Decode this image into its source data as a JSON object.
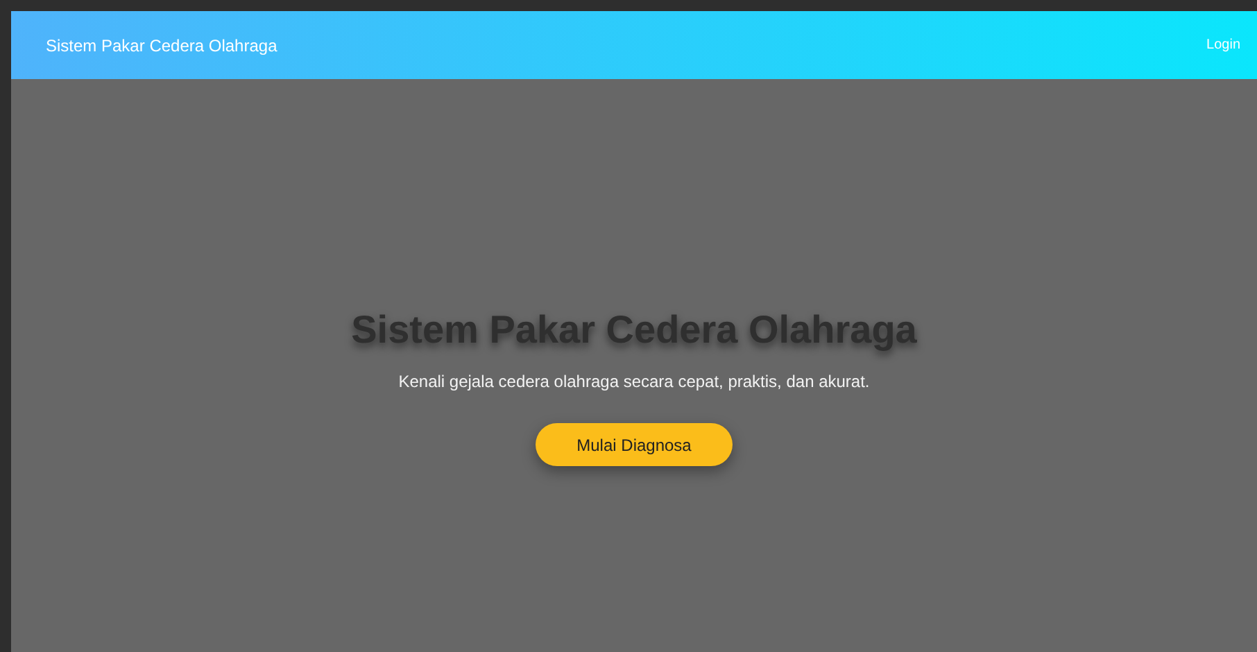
{
  "navbar": {
    "brand": "Sistem Pakar Cedera Olahraga",
    "login": "Login"
  },
  "hero": {
    "title": "Sistem Pakar Cedera Olahraga",
    "subtitle": "Kenali gejala cedera olahraga secara cepat, praktis, dan akurat.",
    "button": "Mulai Diagnosa"
  }
}
